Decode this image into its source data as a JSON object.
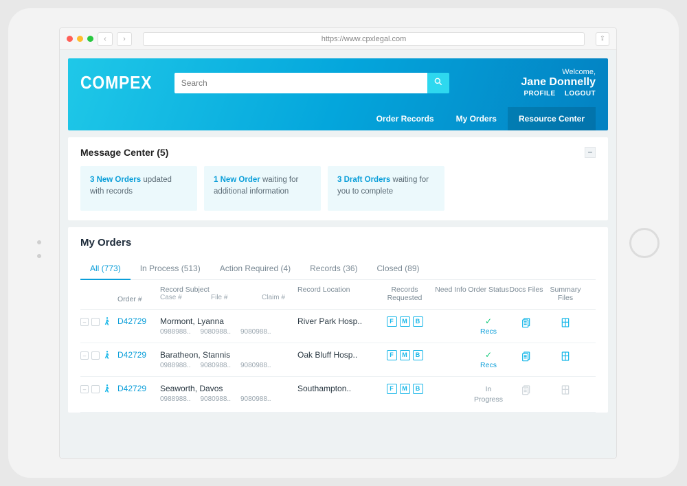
{
  "browser": {
    "url": "https://www.cpxlegal.com"
  },
  "header": {
    "logo": "COMPEX",
    "search_placeholder": "Search",
    "welcome_label": "Welcome,",
    "user_name": "Jane Donnelly",
    "profile_label": "PROFILE",
    "logout_label": "LOGOUT",
    "nav": {
      "order_records": "Order Records",
      "my_orders": "My Orders",
      "resource_center": "Resource Center"
    }
  },
  "message_center": {
    "title": "Message Center (5)",
    "cards": [
      {
        "bold": "3 New Orders",
        "rest": " updated with records"
      },
      {
        "bold": "1 New Order",
        "rest": " waiting for additional information"
      },
      {
        "bold": "3 Draft Orders",
        "rest": " waiting for you to complete"
      }
    ]
  },
  "orders": {
    "title": "My Orders",
    "tabs": {
      "all": "All (773)",
      "in_process": "In Process (513)",
      "action_required": "Action Required (4)",
      "records": "Records (36)",
      "closed": "Closed (89)"
    },
    "columns": {
      "order": "Order #",
      "record_subject": "Record Subject",
      "case": "Case #",
      "file": "File #",
      "claim": "Claim #",
      "record_location": "Record Location",
      "records_requested": "Records Requested",
      "need_info": "Need Info",
      "order_status": "Order Status",
      "docs_files": "Docs Files",
      "summary_files": "Summary Files"
    },
    "rows": [
      {
        "order": "D42729",
        "name": "Mormont, Lyanna",
        "case": "0988988..",
        "file": "9080988..",
        "claim": "9080988..",
        "location": "River Park Hosp..",
        "badges": [
          "F",
          "M",
          "B"
        ],
        "status_check": true,
        "status": "Recs",
        "docs_active": true,
        "summary_active": true
      },
      {
        "order": "D42729",
        "name": "Baratheon, Stannis",
        "case": "0988988..",
        "file": "9080988..",
        "claim": "9080988..",
        "location": "Oak Bluff Hosp..",
        "badges": [
          "F",
          "M",
          "B"
        ],
        "status_check": true,
        "status": "Recs",
        "docs_active": true,
        "summary_active": true
      },
      {
        "order": "D42729",
        "name": "Seaworth, Davos",
        "case": "0988988..",
        "file": "9080988..",
        "claim": "9080988..",
        "location": "Southampton..",
        "badges": [
          "F",
          "M",
          "B"
        ],
        "status_check": false,
        "status": "In Progress",
        "docs_active": false,
        "summary_active": false
      }
    ]
  }
}
